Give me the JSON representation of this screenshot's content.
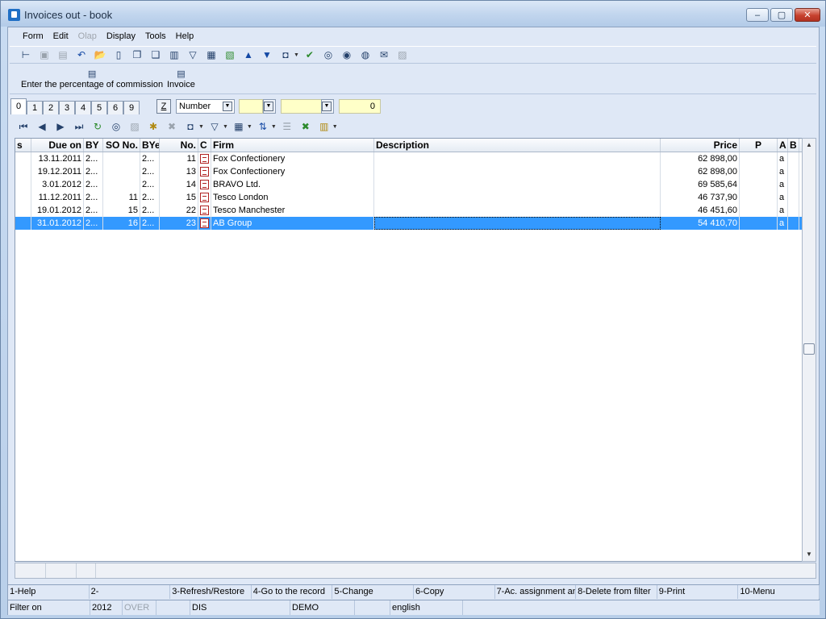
{
  "window": {
    "title": "Invoices out - book"
  },
  "menu": [
    "Form",
    "Edit",
    "Olap",
    "Display",
    "Tools",
    "Help"
  ],
  "commands": [
    {
      "label": "Enter the percentage of commission"
    },
    {
      "label": "Invoice"
    }
  ],
  "tabs": [
    "0",
    "1",
    "2",
    "3",
    "4",
    "5",
    "6",
    "9"
  ],
  "active_tab": "0",
  "filter": {
    "z_label": "Z",
    "sort_field": "Number",
    "numeric_value": "0"
  },
  "grid": {
    "columns": [
      "s",
      "Due on",
      "BY",
      "SO No.",
      "BYe",
      "No.",
      "C",
      "Firm",
      "Description",
      "Price",
      "P",
      "A",
      "B"
    ],
    "rows": [
      {
        "due": "13.11.2011",
        "by": "2...",
        "so": "",
        "bye": "2...",
        "no": "11",
        "firm": "Fox Confectionery",
        "desc": "",
        "price": "62 898,00",
        "a": "a"
      },
      {
        "due": "19.12.2011",
        "by": "2...",
        "so": "",
        "bye": "2...",
        "no": "13",
        "firm": "Fox Confectionery",
        "desc": "",
        "price": "62 898,00",
        "a": "a"
      },
      {
        "due": "3.01.2012",
        "by": "2...",
        "so": "",
        "bye": "2...",
        "no": "14",
        "firm": "BRAVO Ltd.",
        "desc": "",
        "price": "69 585,64",
        "a": "a"
      },
      {
        "due": "11.12.2011",
        "by": "2...",
        "so": "11",
        "bye": "2...",
        "no": "15",
        "firm": "Tesco London",
        "desc": "",
        "price": "46 737,90",
        "a": "a"
      },
      {
        "due": "19.01.2012",
        "by": "2...",
        "so": "15",
        "bye": "2...",
        "no": "22",
        "firm": "Tesco Manchester",
        "desc": "",
        "price": "46 451,60",
        "a": "a"
      },
      {
        "due": "31.01.2012",
        "by": "2...",
        "so": "16",
        "bye": "2...",
        "no": "23",
        "firm": "AB Group",
        "desc": "",
        "price": "54 410,70",
        "a": "a",
        "selected": true
      }
    ]
  },
  "fkeys": [
    "1-Help",
    "2-",
    "3-Refresh/Restore",
    "4-Go to the record",
    "5-Change",
    "6-Copy",
    "7-Ac. assignment an",
    "8-Delete from filter",
    "9-Print",
    "10-Menu"
  ],
  "status": {
    "filter": "Filter on",
    "year": "2012",
    "mode": "OVER",
    "dis": "DIS",
    "db": "DEMO",
    "lang": "english"
  },
  "colors": {
    "selection": "#3399ff",
    "window_bg": "#dfe8f6",
    "input_yellow": "#ffffc8"
  }
}
